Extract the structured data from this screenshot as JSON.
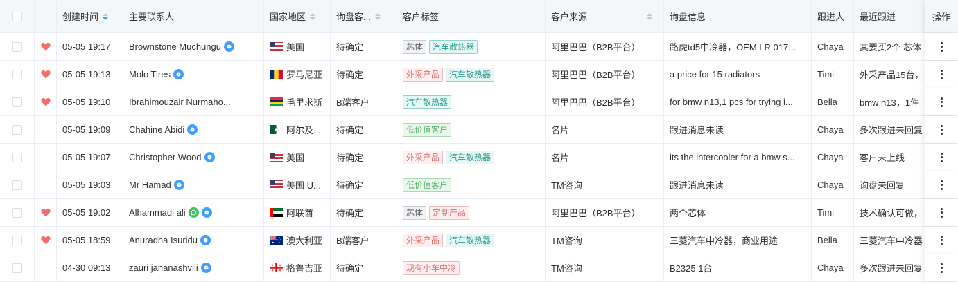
{
  "colors": {
    "accent": "#409eff",
    "heart": "#f56c6c",
    "border": "#ebeef5",
    "header_bg": "#f5f6f8"
  },
  "header": {
    "created_time": "创建时间",
    "contact": "主要联系人",
    "country": "国家地区",
    "stage": "询盘客...",
    "tags": "客户标签",
    "source": "客户来源",
    "info": "询盘信息",
    "owner": "跟进人",
    "recent": "最近跟进",
    "op": "操作"
  },
  "rows": [
    {
      "favorite": true,
      "time": "05-05 19:17",
      "contact": "Brownstone Muchungu",
      "badges": [
        "blue"
      ],
      "flag": "us",
      "country": "美国",
      "stage": "待确定",
      "tags": [
        {
          "text": "芯体",
          "style": "gray"
        },
        {
          "text": "汽车散热器",
          "style": "teal"
        }
      ],
      "source": "阿里巴巴（B2B平台）",
      "info": "路虎td5中冷器，OEM LR 017...",
      "owner": "Chaya",
      "recent": "其要买2个 芯体"
    },
    {
      "favorite": true,
      "time": "05-05 19:13",
      "contact": "Molo Tires",
      "badges": [
        "blue"
      ],
      "flag": "ro",
      "country": "罗马尼亚",
      "stage": "待确定",
      "tags": [
        {
          "text": "外采产品",
          "style": "pink"
        },
        {
          "text": "汽车散热器",
          "style": "teal"
        }
      ],
      "source": "阿里巴巴（B2B平台）",
      "info": "a price for 15 radiators",
      "owner": "Timi",
      "recent": "外采产品15台，"
    },
    {
      "favorite": true,
      "time": "05-05 19:10",
      "contact": "Ibrahimouzair Nurmaho...",
      "badges": [],
      "flag": "mu",
      "country": "毛里求斯",
      "stage": "B端客户",
      "tags": [
        {
          "text": "汽车散热器",
          "style": "teal"
        }
      ],
      "source": "阿里巴巴（B2B平台）",
      "info": "for bmw n13,1 pcs for trying i...",
      "owner": "Bella",
      "recent": "bmw n13，1件"
    },
    {
      "favorite": false,
      "time": "05-05 19:09",
      "contact": "Chahine Abidi",
      "badges": [
        "blue"
      ],
      "flag": "dz",
      "country": "阿尔及...",
      "stage": "待确定",
      "tags": [
        {
          "text": "低价值客户",
          "style": "green"
        }
      ],
      "source": "名片",
      "info": "跟进消息未读",
      "owner": "Chaya",
      "recent": "多次跟进未回复"
    },
    {
      "favorite": false,
      "time": "05-05 19:07",
      "contact": "Christopher Wood",
      "badges": [
        "blue"
      ],
      "flag": "us",
      "country": "美国",
      "stage": "待确定",
      "tags": [
        {
          "text": "外采产品",
          "style": "pink"
        },
        {
          "text": "汽车散热器",
          "style": "teal"
        }
      ],
      "source": "名片",
      "info": "its the intercooler for a bmw s...",
      "owner": "Chaya",
      "recent": "客户未上线"
    },
    {
      "favorite": false,
      "time": "05-05 19:03",
      "contact": "Mr Hamad",
      "badges": [
        "blue"
      ],
      "flag": "us",
      "country": "美国 U...",
      "stage": "待确定",
      "tags": [
        {
          "text": "低价值客户",
          "style": "green"
        }
      ],
      "source": "TM咨询",
      "info": "跟进消息未读",
      "owner": "Chaya",
      "recent": "询盘未回复"
    },
    {
      "favorite": true,
      "time": "05-05 19:02",
      "contact": "Alhammadi ali",
      "badges": [
        "green",
        "blue"
      ],
      "flag": "ae",
      "country": "阿联酋",
      "stage": "待确定",
      "tags": [
        {
          "text": "芯体",
          "style": "gray"
        },
        {
          "text": "定制产品",
          "style": "pink"
        }
      ],
      "source": "阿里巴巴（B2B平台）",
      "info": "两个芯体",
      "owner": "Timi",
      "recent": "技术确认可做，"
    },
    {
      "favorite": true,
      "time": "05-05 18:59",
      "contact": "Anuradha Isuridu",
      "badges": [
        "blue"
      ],
      "flag": "au",
      "country": "澳大利亚",
      "stage": "B端客户",
      "tags": [
        {
          "text": "外采产品",
          "style": "pink"
        },
        {
          "text": "汽车散热器",
          "style": "teal"
        }
      ],
      "source": "TM咨询",
      "info": "三菱汽车中冷器，商业用途",
      "owner": "Bella",
      "recent": "三菱汽车中冷器"
    },
    {
      "favorite": false,
      "time": "04-30 09:13",
      "contact": "zauri jananashvili",
      "badges": [
        "blue"
      ],
      "flag": "ge",
      "country": "格鲁吉亚",
      "stage": "待确定",
      "tags": [
        {
          "text": "现有小车中冷",
          "style": "pink"
        }
      ],
      "source": "TM咨询",
      "info": "B2325 1台",
      "owner": "Chaya",
      "recent": "多次跟进未回复"
    }
  ]
}
